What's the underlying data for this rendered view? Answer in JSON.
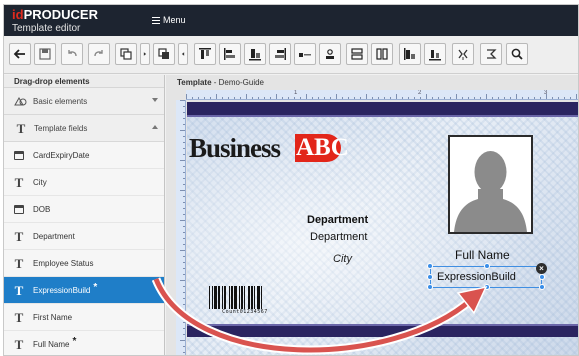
{
  "app": {
    "logo_id": "id",
    "logo_product": "PRODUCER",
    "subtitle": "Template editor",
    "menu_label": "Menu"
  },
  "toolbar": {
    "buttons": [
      "back-arrow-icon",
      "save-icon",
      "undo-icon",
      "redo-icon",
      "copy-icon",
      "more-icon",
      "paste-icon",
      "left-arrow-icon",
      "align-top-icon",
      "align-left-icon",
      "align-center-icon",
      "align-right-icon",
      "align-bottom-icon",
      "align-middle-icon",
      "distribute-horizontal-icon",
      "distribute-vertical-icon",
      "same-width-icon",
      "same-height-icon",
      "flip-horizontal-icon",
      "flip-vertical-icon",
      "zoom-icon"
    ]
  },
  "left_panel": {
    "header": "Drag-drop elements",
    "sections": [
      {
        "label": "Basic elements",
        "state": "collapsed"
      },
      {
        "label": "Template fields",
        "state": "expanded"
      }
    ],
    "items": [
      {
        "label": "CardExpiryDate",
        "icon": "calendar-icon",
        "starred": false,
        "selected": false
      },
      {
        "label": "City",
        "icon": "text-field-icon",
        "starred": false,
        "selected": false
      },
      {
        "label": "DOB",
        "icon": "calendar-icon",
        "starred": false,
        "selected": false
      },
      {
        "label": "Department",
        "icon": "text-field-icon",
        "starred": false,
        "selected": false
      },
      {
        "label": "Employee Status",
        "icon": "text-field-icon",
        "starred": false,
        "selected": false
      },
      {
        "label": "ExpressionBuild",
        "icon": "text-field-icon",
        "starred": true,
        "selected": true
      },
      {
        "label": "First Name",
        "icon": "text-field-icon",
        "starred": false,
        "selected": false
      },
      {
        "label": "Full Name",
        "icon": "text-field-icon",
        "starred": true,
        "selected": false
      }
    ],
    "star": "*"
  },
  "workspace": {
    "title_bold": "Template",
    "title_rest": " - Demo-Guide",
    "ruler_labels": [
      "1",
      "2",
      "3"
    ]
  },
  "card": {
    "brand_business": "Business",
    "brand_abc": "ABC",
    "department_bold": "Department",
    "department": "Department",
    "city": "City",
    "full_name": "Full Name",
    "expression_text": "ExpressionBuild",
    "remove_glyph": "×",
    "barcode_text": "Count01234567",
    "colors": {
      "stripe": "#2a2460",
      "brand_red": "#e2261a",
      "selection": "#3f8ee2",
      "drag_arrow": "#d9534f"
    }
  }
}
